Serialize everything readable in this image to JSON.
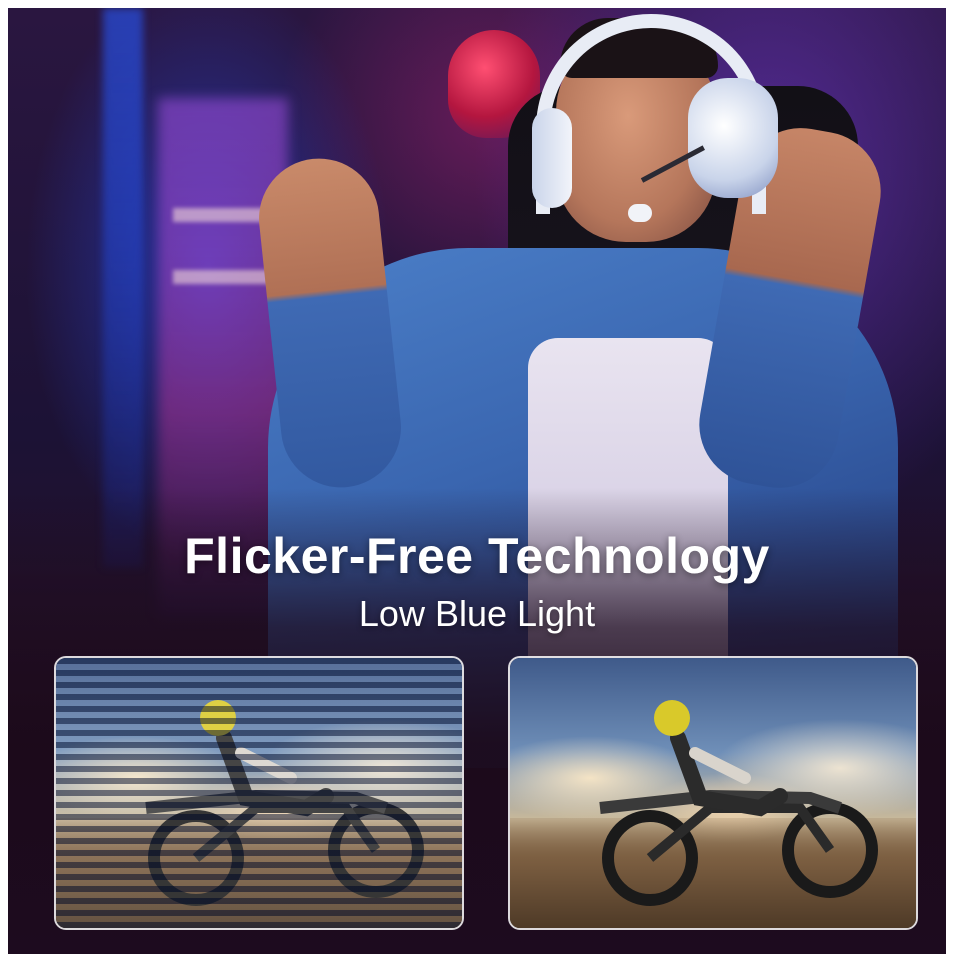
{
  "hero": {
    "headline": "Flicker-Free Technology",
    "subheadline": "Low Blue Light"
  },
  "comparison": {
    "left": {
      "state": "flicker"
    },
    "right": {
      "state": "flicker-free"
    }
  },
  "colors": {
    "text": "#ffffff",
    "panel_border": "#ffffff",
    "background_dark": "#1d0b1f",
    "neon_purple": "#7a3cdc",
    "neon_blue": "#2850ff"
  }
}
